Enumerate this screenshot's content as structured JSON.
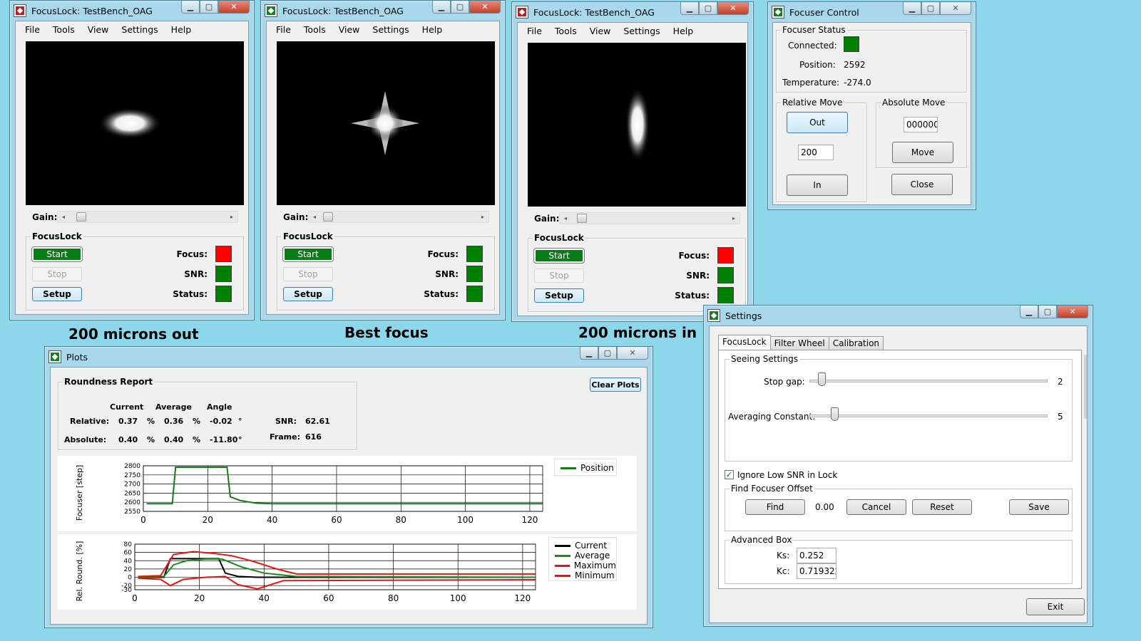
{
  "focuslock_windows": [
    {
      "title": "FocusLock: TestBench_OAG",
      "menu": [
        "File",
        "Tools",
        "View",
        "Settings",
        "Help"
      ],
      "gain_label": "Gain:",
      "group_title": "FocusLock",
      "start_label": "Start",
      "stop_label": "Stop",
      "setup_label": "Setup",
      "focus_label": "Focus:",
      "snr_label": "SNR:",
      "status_label": "Status:",
      "star_shape": "horizontal-oval",
      "focus_color": "red",
      "snr_color": "green",
      "status_color": "green",
      "caption": "200 microns out"
    },
    {
      "title": "FocusLock: TestBench_OAG",
      "menu": [
        "File",
        "Tools",
        "View",
        "Settings",
        "Help"
      ],
      "gain_label": "Gain:",
      "group_title": "FocusLock",
      "start_label": "Start",
      "stop_label": "Stop",
      "setup_label": "Setup",
      "focus_label": "Focus:",
      "snr_label": "SNR:",
      "status_label": "Status:",
      "star_shape": "four-point-star",
      "focus_color": "green",
      "snr_color": "green",
      "status_color": "green",
      "caption": "Best focus"
    },
    {
      "title": "FocusLock: TestBench_OAG",
      "menu": [
        "File",
        "Tools",
        "View",
        "Settings",
        "Help"
      ],
      "gain_label": "Gain:",
      "group_title": "FocusLock",
      "start_label": "Start",
      "stop_label": "Stop",
      "setup_label": "Setup",
      "focus_label": "Focus:",
      "snr_label": "SNR:",
      "status_label": "Status:",
      "star_shape": "vertical-oval",
      "focus_color": "red",
      "snr_color": "green",
      "status_color": "green",
      "caption": "200 microns in"
    }
  ],
  "focuser_control": {
    "title": "Focuser Control",
    "status_group": "Focuser Status",
    "connected_label": "Connected:",
    "connected_color": "green",
    "position_label": "Position:",
    "position_value": "2592",
    "temperature_label": "Temperature:",
    "temperature_value": "-274.0",
    "relative_group": "Relative Move",
    "out_label": "Out",
    "step_value": "200",
    "in_label": "In",
    "absolute_group": "Absolute Move",
    "absolute_value": "000000",
    "move_label": "Move",
    "close_label": "Close"
  },
  "settings": {
    "title": "Settings",
    "tabs": [
      "FocusLock",
      "Filter Wheel",
      "Calibration"
    ],
    "seeing_group": "Seeing Settings",
    "stop_gap_label": "Stop gap:",
    "stop_gap_value": "2",
    "stop_gap_level": 0.04,
    "averaging_label": "Averaging Constant:",
    "averaging_value": "5",
    "averaging_level": 0.1,
    "ignore_snr_label": "Ignore Low SNR in Lock",
    "ignore_snr_checked": true,
    "find_offset_group": "Find Focuser Offset",
    "find_label": "Find",
    "offset_value": "0.00",
    "cancel_label": "Cancel",
    "reset_label": "Reset",
    "save_label": "Save",
    "advanced_group": "Advanced Box",
    "ks_label": "Ks:",
    "ks_value": "0.252",
    "kc_label": "Kc:",
    "kc_value": "0.7193224",
    "exit_label": "Exit"
  },
  "plots": {
    "title": "Plots",
    "roundness_group": "Roundness Report",
    "clear_label": "Clear Plots",
    "col_current": "Current",
    "col_average": "Average",
    "col_angle": "Angle",
    "relative_label": "Relative:",
    "absolute_label": "Absolute:",
    "rel_current": "0.37",
    "rel_average": "0.36",
    "rel_angle": "-0.02",
    "abs_current": "0.40",
    "abs_average": "0.40",
    "abs_angle": "-11.80",
    "pct": "%",
    "deg": "°",
    "snr_label": "SNR:",
    "snr_value": "62.61",
    "frame_label": "Frame:",
    "frame_value": "616"
  },
  "chart_data": [
    {
      "type": "line",
      "ylabel": "Focuser [step]",
      "xlim": [
        0,
        124
      ],
      "ylim": [
        2550,
        2800
      ],
      "xticks": [
        "0",
        "20",
        "40",
        "60",
        "80",
        "100",
        "120"
      ],
      "yticks": [
        "2800",
        "2750",
        "2700",
        "2650",
        "2600",
        "2550"
      ],
      "grid": true,
      "legend_position": "top-right",
      "series": [
        {
          "name": "Position",
          "color": "#1a7a1a",
          "x": [
            1,
            9,
            10,
            26,
            27,
            30,
            35,
            40,
            124
          ],
          "y": [
            2592,
            2592,
            2792,
            2792,
            2630,
            2610,
            2595,
            2592,
            2592
          ]
        }
      ]
    },
    {
      "type": "line",
      "ylabel": "Rel. Round. [%]",
      "xlim": [
        0,
        124
      ],
      "ylim": [
        -30,
        80
      ],
      "xticks": [
        "0",
        "20",
        "40",
        "60",
        "80",
        "100",
        "120"
      ],
      "yticks": [
        "80",
        "60",
        "40",
        "20",
        "0",
        "-20",
        "-30"
      ],
      "grid": true,
      "legend_position": "top-right",
      "series": [
        {
          "name": "Current",
          "color": "#000000",
          "x": [
            1,
            9,
            11,
            26,
            28,
            32,
            38,
            124
          ],
          "y": [
            0,
            0,
            45,
            45,
            10,
            2,
            0,
            0
          ]
        },
        {
          "name": "Average",
          "color": "#1a8a1a",
          "x": [
            1,
            9,
            12,
            16,
            22,
            27,
            33,
            40,
            50,
            124
          ],
          "y": [
            0,
            2,
            30,
            40,
            44,
            44,
            25,
            10,
            2,
            0
          ]
        },
        {
          "name": "Maximum",
          "color": "#ee1111",
          "x": [
            1,
            8,
            12,
            18,
            24,
            30,
            36,
            44,
            50,
            124
          ],
          "y": [
            2,
            4,
            55,
            62,
            58,
            52,
            40,
            20,
            8,
            8
          ]
        },
        {
          "name": "Minimum",
          "color": "#ee1111",
          "x": [
            1,
            8,
            11,
            15,
            22,
            28,
            32,
            38,
            46,
            124
          ],
          "y": [
            -2,
            -5,
            -20,
            -5,
            0,
            2,
            -18,
            -28,
            -8,
            -6
          ]
        }
      ]
    }
  ]
}
